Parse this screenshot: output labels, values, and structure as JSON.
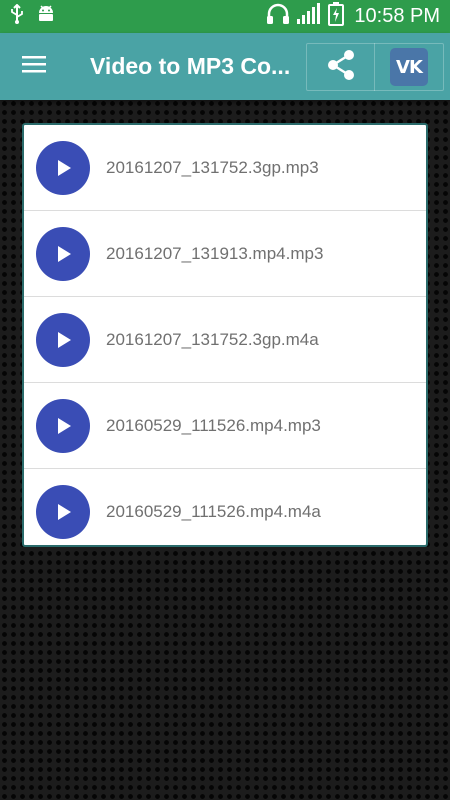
{
  "status_bar": {
    "time": "10:58 PM",
    "left_icons": [
      "usb-icon",
      "android-icon"
    ],
    "right_icons": [
      "headphones-icon",
      "signal-icon",
      "battery-charging-icon"
    ]
  },
  "toolbar": {
    "title": "Video to MP3 Co...",
    "menu_icon": "hamburger-menu-icon",
    "share_icon": "share-icon",
    "vk_label": "VK",
    "background_color": "#4aa3a5"
  },
  "files": [
    {
      "name": "20161207_131752.3gp.mp3"
    },
    {
      "name": "20161207_131913.mp4.mp3"
    },
    {
      "name": "20161207_131752.3gp.m4a"
    },
    {
      "name": "20160529_111526.mp4.mp3"
    },
    {
      "name": "20160529_111526.mp4.m4a"
    }
  ],
  "colors": {
    "status_bar": "#2e9c4c",
    "play_button": "#3a4db5",
    "file_text": "#707070"
  }
}
